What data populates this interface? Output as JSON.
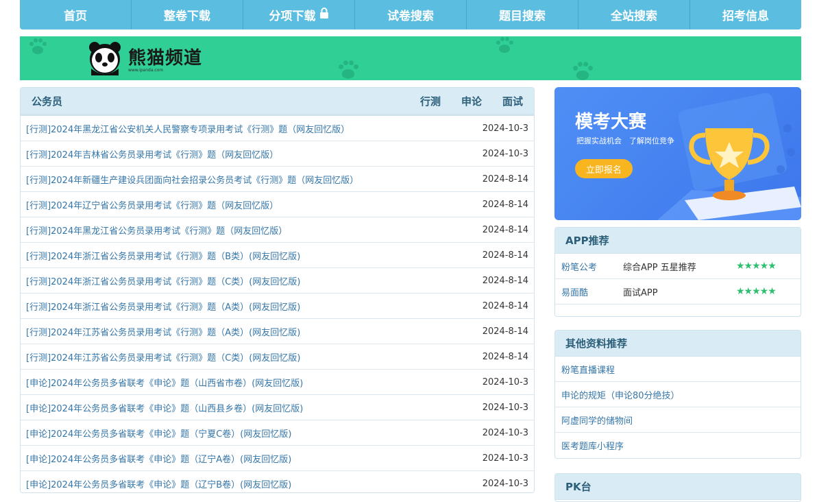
{
  "nav": {
    "items": [
      "首页",
      "整卷下载",
      "分项下载",
      "试卷搜索",
      "题目搜索",
      "全站搜索",
      "招考信息"
    ]
  },
  "banner": {
    "logo_title": "熊猫频道",
    "logo_url": "www.ipanda.com"
  },
  "list": {
    "title": "公务员",
    "tabs": [
      "行测",
      "申论",
      "面试"
    ],
    "rows": [
      {
        "title": "[行测]2024年黑龙江省公安机关人民警察专项录用考试《行测》题（网友回忆版）",
        "date": "2024-10-3"
      },
      {
        "title": "[行测]2024年吉林省公务员录用考试《行测》题（网友回忆版）",
        "date": "2024-10-3"
      },
      {
        "title": "[行测]2024年新疆生产建设兵团面向社会招录公务员考试《行测》题（网友回忆版）",
        "date": "2024-8-14"
      },
      {
        "title": "[行测]2024年辽宁省公务员录用考试《行测》题（网友回忆版）",
        "date": "2024-8-14"
      },
      {
        "title": "[行测]2024年黑龙江省公务员录用考试《行测》题（网友回忆版）",
        "date": "2024-8-14"
      },
      {
        "title": "[行测]2024年浙江省公务员录用考试《行测》题（B类）(网友回忆版)",
        "date": "2024-8-14"
      },
      {
        "title": "[行测]2024年浙江省公务员录用考试《行测》题（C类）(网友回忆版)",
        "date": "2024-8-14"
      },
      {
        "title": "[行测]2024年浙江省公务员录用考试《行测》题（A类）(网友回忆版)",
        "date": "2024-8-14"
      },
      {
        "title": "[行测]2024年江苏省公务员录用考试《行测》题（A类）(网友回忆版)",
        "date": "2024-8-14"
      },
      {
        "title": "[行测]2024年江苏省公务员录用考试《行测》题（C类）(网友回忆版)",
        "date": "2024-8-14"
      },
      {
        "title": "[申论]2024年公务员多省联考《申论》题（山西省市卷）(网友回忆版)",
        "date": "2024-10-3"
      },
      {
        "title": "[申论]2024年公务员多省联考《申论》题（山西县乡卷）(网友回忆版)",
        "date": "2024-10-3"
      },
      {
        "title": "[申论]2024年公务员多省联考《申论》题（宁夏C卷）(网友回忆版)",
        "date": "2024-10-3"
      },
      {
        "title": "[申论]2024年公务员多省联考《申论》题（辽宁A卷）(网友回忆版)",
        "date": "2024-10-3"
      },
      {
        "title": "[申论]2024年公务员多省联考《申论》题（辽宁B卷）(网友回忆版)",
        "date": "2024-10-3"
      }
    ]
  },
  "promo": {
    "title": "模考大赛",
    "subtitle": "把握实战机会　了解岗位竞争",
    "button": "立即报名"
  },
  "app_box": {
    "title": "APP推荐",
    "items": [
      {
        "name": "粉笔公考",
        "desc": "综合APP 五星推荐",
        "stars": "★★★★★"
      },
      {
        "name": "易面酷",
        "desc": "面试APP",
        "stars": "★★★★★"
      }
    ]
  },
  "res_box": {
    "title": "其他资料推荐",
    "items": [
      "粉笔直播课程",
      "申论的规矩（申论80分绝技）",
      "阿虚同学的储物间",
      "医考题库小程序"
    ]
  },
  "pk_box": {
    "title": "PK台"
  },
  "colors": {
    "nav_bg": "#5bbde0",
    "banner_bg": "#2fcf96",
    "link": "#3576a8",
    "promo_btn": "#f9b520",
    "stars": "#2fbf71"
  }
}
